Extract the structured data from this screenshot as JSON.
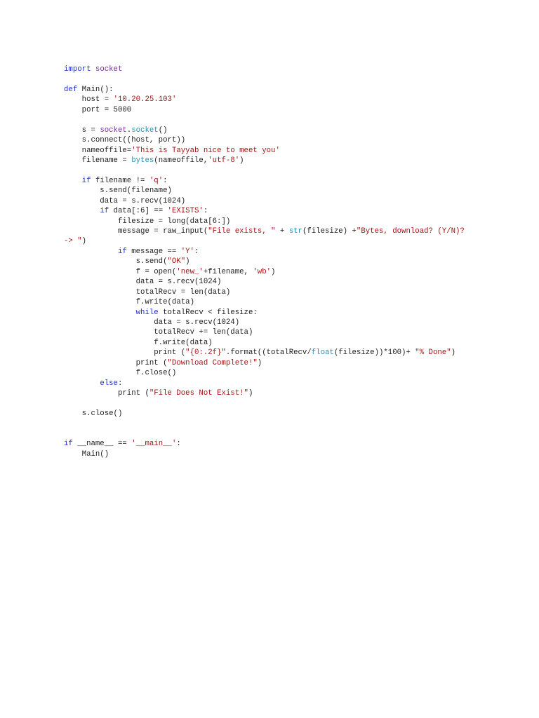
{
  "colors": {
    "keyword": "#2034c8",
    "string": "#a31515",
    "builtin": "#2b91af",
    "module": "#7b2d9e",
    "text": "#1e1e1e"
  },
  "code_lines": [
    [
      [
        "kw",
        "import"
      ],
      [
        "t",
        " "
      ],
      [
        "mod",
        "socket"
      ]
    ],
    [],
    [
      [
        "kw",
        "def"
      ],
      [
        "t",
        " Main():"
      ]
    ],
    [
      [
        "t",
        "    host = "
      ],
      [
        "str",
        "'10.20.25.103'"
      ]
    ],
    [
      [
        "t",
        "    port = 5000"
      ]
    ],
    [],
    [
      [
        "t",
        "    s = "
      ],
      [
        "mod",
        "socket"
      ],
      [
        "t",
        "."
      ],
      [
        "bi",
        "socket"
      ],
      [
        "t",
        "()"
      ]
    ],
    [
      [
        "t",
        "    s.connect((host, port))"
      ]
    ],
    [
      [
        "t",
        "    nameoffile="
      ],
      [
        "str",
        "'This is Tayyab nice to meet you'"
      ]
    ],
    [
      [
        "t",
        "    filename = "
      ],
      [
        "bi",
        "bytes"
      ],
      [
        "t",
        "(nameoffile,"
      ],
      [
        "str",
        "'utf-8'"
      ],
      [
        "t",
        ")"
      ]
    ],
    [],
    [
      [
        "t",
        "    "
      ],
      [
        "kw",
        "if"
      ],
      [
        "t",
        " filename != "
      ],
      [
        "str",
        "'q'"
      ],
      [
        "t",
        ":"
      ]
    ],
    [
      [
        "t",
        "        s.send(filename)"
      ]
    ],
    [
      [
        "t",
        "        data = s.recv(1024)"
      ]
    ],
    [
      [
        "t",
        "        "
      ],
      [
        "kw",
        "if"
      ],
      [
        "t",
        " data[:6] == "
      ],
      [
        "str",
        "'EXISTS'"
      ],
      [
        "t",
        ":"
      ]
    ],
    [
      [
        "t",
        "            filesize = long(data[6:])"
      ]
    ],
    [
      [
        "t",
        "            message = raw_input("
      ],
      [
        "str",
        "\"File exists, \""
      ],
      [
        "t",
        " + "
      ],
      [
        "bi",
        "str"
      ],
      [
        "t",
        "(filesize) +"
      ],
      [
        "str",
        "\"Bytes, download? (Y/N)?"
      ]
    ],
    [
      [
        "str",
        "-> \""
      ],
      [
        "t",
        ")"
      ]
    ],
    [
      [
        "t",
        "            "
      ],
      [
        "kw",
        "if"
      ],
      [
        "t",
        " message == "
      ],
      [
        "str",
        "'Y'"
      ],
      [
        "t",
        ":"
      ]
    ],
    [
      [
        "t",
        "                s.send("
      ],
      [
        "str",
        "\"OK\""
      ],
      [
        "t",
        ")"
      ]
    ],
    [
      [
        "t",
        "                f = open("
      ],
      [
        "str",
        "'new_'"
      ],
      [
        "t",
        "+filename, "
      ],
      [
        "str",
        "'wb'"
      ],
      [
        "t",
        ")"
      ]
    ],
    [
      [
        "t",
        "                data = s.recv(1024)"
      ]
    ],
    [
      [
        "t",
        "                totalRecv = len(data)"
      ]
    ],
    [
      [
        "t",
        "                f.write(data)"
      ]
    ],
    [
      [
        "t",
        "                "
      ],
      [
        "kw",
        "while"
      ],
      [
        "t",
        " totalRecv < filesize:"
      ]
    ],
    [
      [
        "t",
        "                    data = s.recv(1024)"
      ]
    ],
    [
      [
        "t",
        "                    totalRecv += len(data)"
      ]
    ],
    [
      [
        "t",
        "                    f.write(data)"
      ]
    ],
    [
      [
        "t",
        "                    print ("
      ],
      [
        "str",
        "\"{0:.2f}\""
      ],
      [
        "t",
        ".format((totalRecv/"
      ],
      [
        "bi",
        "float"
      ],
      [
        "t",
        "(filesize))*100)+ "
      ],
      [
        "str",
        "\"% Done\""
      ],
      [
        "t",
        ")"
      ]
    ],
    [
      [
        "t",
        "                print ("
      ],
      [
        "str",
        "\"Download Complete!\""
      ],
      [
        "t",
        ")"
      ]
    ],
    [
      [
        "t",
        "                f.close()"
      ]
    ],
    [
      [
        "t",
        "        "
      ],
      [
        "kw",
        "else"
      ],
      [
        "t",
        ":"
      ]
    ],
    [
      [
        "t",
        "            print ("
      ],
      [
        "str",
        "\"File Does Not Exist!\""
      ],
      [
        "t",
        ")"
      ]
    ],
    [],
    [
      [
        "t",
        "    s.close()"
      ]
    ],
    [],
    [],
    [
      [
        "kw",
        "if"
      ],
      [
        "t",
        " __name__ == "
      ],
      [
        "str",
        "'__main__'"
      ],
      [
        "t",
        ":"
      ]
    ],
    [
      [
        "t",
        "    Main()"
      ]
    ]
  ]
}
